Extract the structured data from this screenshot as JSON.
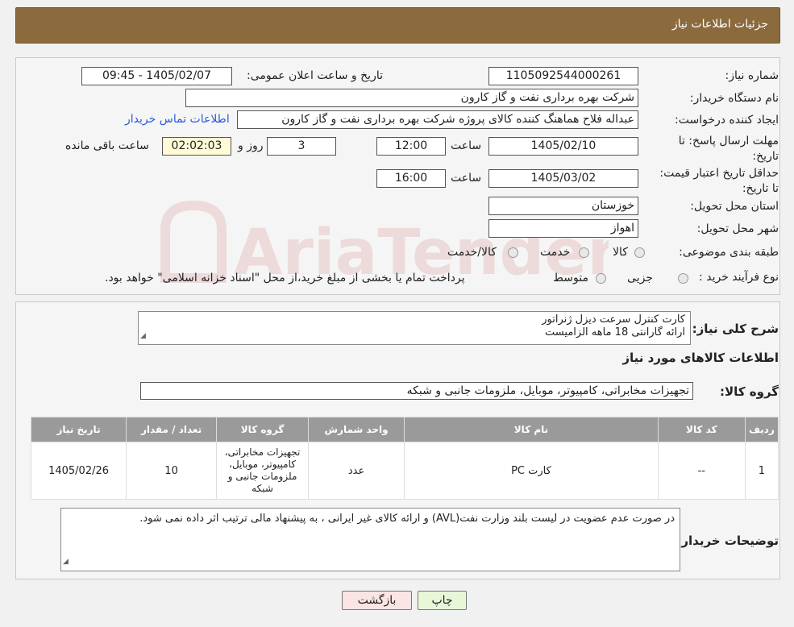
{
  "header": {
    "title": "جزئیات اطلاعات نیاز"
  },
  "form": {
    "need_number_label": "شماره نیاز:",
    "need_number": "1105092544000261",
    "announce_label": "تاریخ و ساعت اعلان عمومی:",
    "announce_value": "1405/02/07 - 09:45",
    "buyer_label": "نام دستگاه خریدار:",
    "buyer_value": "شرکت بهره برداری نفت و گاز کارون",
    "creator_label": "ایجاد کننده درخواست:",
    "creator_value": "عبداله فلاح هماهنگ کننده کالای پروژه شرکت بهره برداری نفت و گاز کارون",
    "contact_link": "اطلاعات تماس خریدار",
    "deadline_label": "مهلت ارسال پاسخ: تا تاریخ:",
    "deadline_date": "1405/02/10",
    "time_label": "ساعت",
    "deadline_time": "12:00",
    "days_value": "3",
    "days_label": "روز و",
    "remaining_time": "02:02:03",
    "remaining_label": "ساعت باقی مانده",
    "validity_label": "حداقل تاریخ اعتبار قیمت: تا تاریخ:",
    "validity_date": "1405/03/02",
    "validity_time": "16:00",
    "province_label": "استان محل تحویل:",
    "province_value": "خوزستان",
    "city_label": "شهر محل تحویل:",
    "city_value": "اهواز",
    "category_label": "طبقه بندی موضوعی:",
    "category_options": [
      "کالا",
      "خدمت",
      "کالا/خدمت"
    ],
    "process_label": "نوع فرآیند خرید :",
    "process_options": [
      "جزیی",
      "متوسط"
    ],
    "process_note": "پرداخت تمام یا بخشی از مبلغ خرید،از محل \"اسناد خزانه اسلامی\" خواهد بود."
  },
  "summary": {
    "label": "شرح کلی نیاز:",
    "line1": "کارت کنترل سرعت دیزل ژنراتور",
    "line2": "ارائه گارانتی 18 ماهه الزامیست"
  },
  "goods": {
    "section_title": "اطلاعات کالاهای مورد نیاز",
    "group_label": "گروه کالا:",
    "group_value": "تجهیزات مخابراتی، کامپیوتر، موبایل، ملزومات جانبی و شبکه",
    "columns": [
      "ردیف",
      "کد کالا",
      "نام کالا",
      "واحد شمارش",
      "گروه کالا",
      "تعداد / مقدار",
      "تاریخ نیاز"
    ],
    "rows": [
      [
        "1",
        "--",
        "کارت PC",
        "عدد",
        "تجهیزات مخابراتی، کامپیوتر، موبایل، ملزومات جانبی و شبکه",
        "10",
        "1405/02/26"
      ]
    ]
  },
  "notes": {
    "label": "توضیحات خریدار:",
    "text": "در صورت عدم عضویت در لیست بلند وزارت نفت(AVL) و ارائه کالای غیر ایرانی ، به پیشنهاد مالی ترتیب اثر داده نمی شود."
  },
  "buttons": {
    "print": "چاپ",
    "back": "بازگشت"
  },
  "watermark": {
    "text": "AriaTender.neT"
  }
}
